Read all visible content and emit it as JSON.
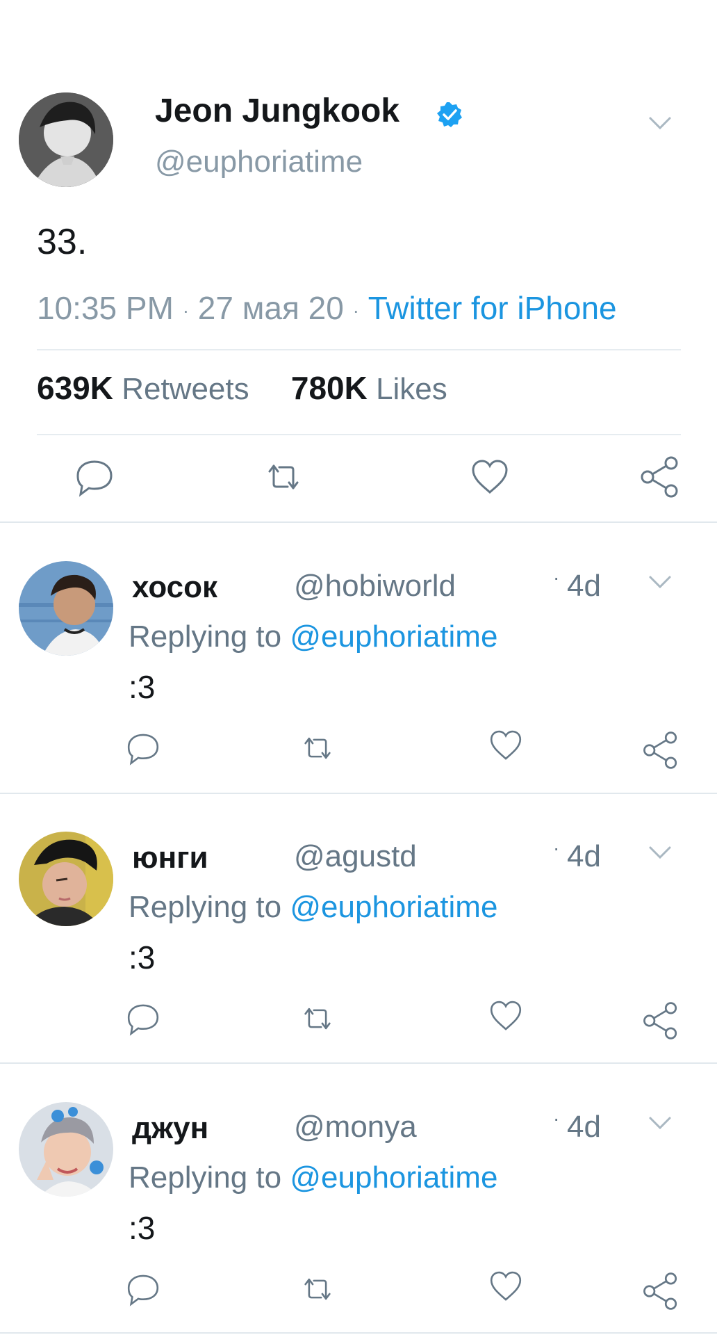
{
  "main_tweet": {
    "author_name": "Jeon Jungkook",
    "handle": "@euphoriatime",
    "text": "33.",
    "time": "10:35 PM",
    "date": "27 мая 20",
    "source": "Twitter for iPhone",
    "dot": "·",
    "retweets_count": "639K",
    "retweets_label": "Retweets",
    "likes_count": "780K",
    "likes_label": "Likes"
  },
  "replies": [
    {
      "name": "хосок",
      "handle": "@hobiworld",
      "dot": "·",
      "time": "4d",
      "replying_label": "Replying to",
      "replying_to": "@euphoriatime",
      "text": ":3"
    },
    {
      "name": "юнги",
      "handle": "@agustd",
      "dot": "·",
      "time": "4d",
      "replying_label": "Replying to",
      "replying_to": "@euphoriatime",
      "text": ":3"
    },
    {
      "name": "джун",
      "handle": "@monya",
      "dot": "·",
      "time": "4d",
      "replying_label": "Replying to",
      "replying_to": "@euphoriatime",
      "text": ":3"
    }
  ],
  "colors": {
    "accent": "#1b95e0",
    "verified": "#1da1f2",
    "text_primary": "#14171a",
    "text_secondary": "#657786",
    "divider": "#e6ecf0"
  },
  "icons": [
    "verified-badge-icon",
    "chevron-down-icon",
    "reply-icon",
    "retweet-icon",
    "like-icon",
    "share-icon"
  ]
}
